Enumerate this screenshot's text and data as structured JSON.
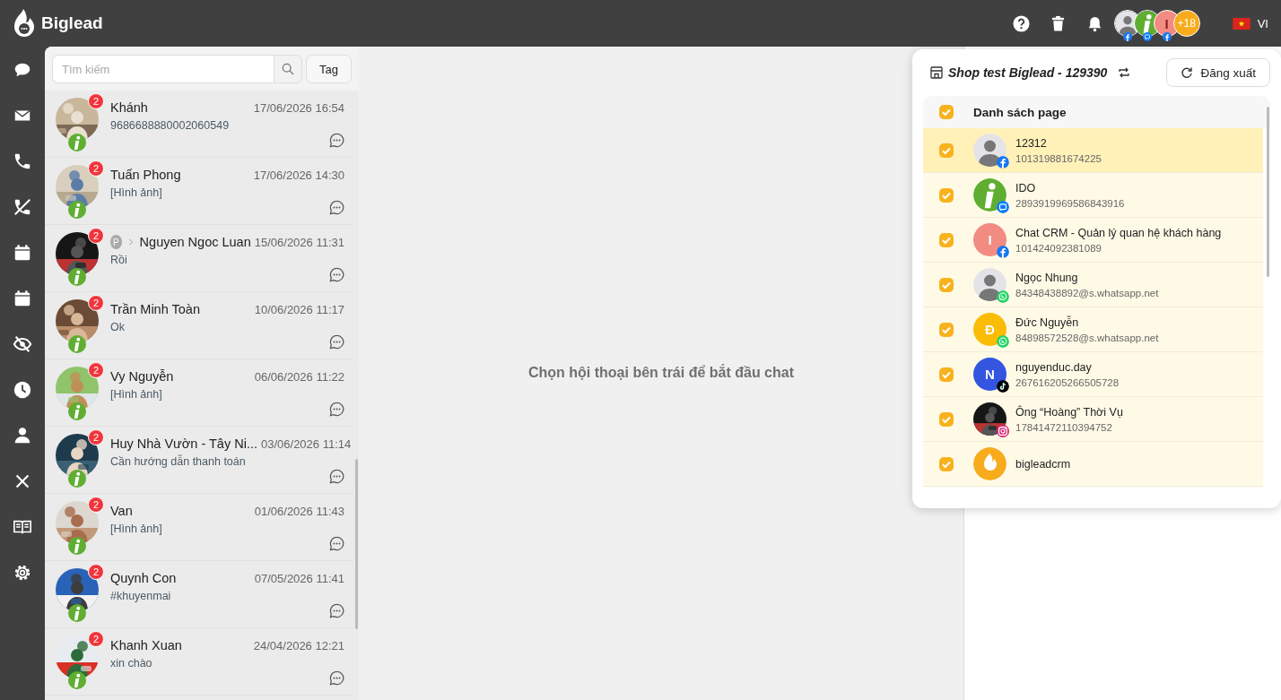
{
  "brand": {
    "name": "Biglead"
  },
  "header": {
    "accounts": [
      {
        "kind": "person",
        "badge": {
          "kind": "facebook"
        }
      },
      {
        "kind": "logo",
        "badge": {
          "kind": "zalo"
        }
      },
      {
        "kind": "initial",
        "initial": "I",
        "color": "#f28b82",
        "badge": {
          "kind": "facebook"
        }
      },
      {
        "kind": "more",
        "label": "+18",
        "color": "#f8ab1c"
      }
    ],
    "language": "VI"
  },
  "sidebar": {
    "items": [
      {
        "kind": "chat"
      },
      {
        "kind": "mail"
      },
      {
        "kind": "phone"
      },
      {
        "kind": "missed-call"
      },
      {
        "kind": "calendar"
      },
      {
        "kind": "calendar"
      },
      {
        "kind": "eye-off"
      },
      {
        "kind": "clock"
      },
      {
        "kind": "person"
      },
      {
        "kind": "close"
      },
      {
        "kind": "book"
      },
      {
        "kind": "settings"
      }
    ]
  },
  "search": {
    "placeholder": "Tìm kiếm",
    "tag_button": "Tag"
  },
  "conversations": [
    {
      "name": "Khánh",
      "time": "17/06/2026 16:54",
      "preview": "9686688880002060549",
      "unread": "2"
    },
    {
      "name": "Tuấn Phong",
      "time": "17/06/2026 14:30",
      "preview": "[Hình ảnh]",
      "unread": "2"
    },
    {
      "name": "Nguyen Ngoc Luan",
      "via": "P",
      "time": "15/06/2026 11:31",
      "preview": "Rồi",
      "unread": "2"
    },
    {
      "name": "Trần Minh Toàn",
      "time": "10/06/2026 11:17",
      "preview": "Ok",
      "unread": "2"
    },
    {
      "name": "Vy Nguyễn",
      "time": "06/06/2026 11:22",
      "preview": "[Hình ảnh]",
      "unread": "2"
    },
    {
      "name": "Huy Nhà Vườn - Tây Ni...",
      "time": "03/06/2026 11:14",
      "preview": "Cần hướng dẫn thanh toán",
      "unread": "2"
    },
    {
      "name": "Van",
      "time": "01/06/2026 11:43",
      "preview": "[Hình ảnh]",
      "unread": "2"
    },
    {
      "name": "Quynh Con",
      "time": "07/05/2026 11:41",
      "preview": "#khuyenmai",
      "unread": "2"
    },
    {
      "name": "Khanh Xuan",
      "time": "24/04/2026 12:21",
      "preview": "xin chào",
      "unread": "2"
    }
  ],
  "empty_state": "Chọn hội thoại bên trái để bắt đầu chat",
  "popup": {
    "shop": "Shop test Biglead - 129390",
    "logout": "Đăng xuất",
    "list_title": "Danh sách page",
    "all_checked": true,
    "pages": [
      {
        "name": "12312",
        "id": "101319881674225",
        "kind": "person",
        "badge": {
          "kind": "facebook"
        },
        "checked": true,
        "selected": true
      },
      {
        "name": "IDO",
        "id": "2893919969586843916",
        "kind": "logo",
        "badge": {
          "kind": "zalo"
        },
        "checked": true,
        "selected": false
      },
      {
        "name": "Chat CRM - Quản lý quan hệ khách hàng",
        "id": "101424092381089",
        "kind": "initial",
        "initial": "I",
        "color": "#f28b82",
        "badge": {
          "kind": "facebook"
        },
        "checked": true,
        "selected": false
      },
      {
        "name": "Ngọc Nhung",
        "id": "84348438892@s.whatsapp.net",
        "kind": "person-dark",
        "badge": {
          "kind": "whatsapp"
        },
        "checked": true,
        "selected": false
      },
      {
        "name": "Đức Nguyễn",
        "id": "84898572528@s.whatsapp.net",
        "kind": "initial",
        "initial": "Đ",
        "color": "#fbbc05",
        "badge": {
          "kind": "whatsapp"
        },
        "checked": true,
        "selected": false
      },
      {
        "name": "nguyenduc.day",
        "id": "267616205266505728",
        "kind": "initial",
        "initial": "N",
        "color": "#3355e0",
        "badge": {
          "kind": "tiktok"
        },
        "checked": true,
        "selected": false
      },
      {
        "name": "Ông “Hoàng” Thời Vụ",
        "id": "17841472110394752",
        "kind": "picture",
        "badge": {
          "kind": "instagram"
        },
        "checked": true,
        "selected": false
      },
      {
        "name": "bigleadcrm",
        "kind": "brand",
        "checked": true,
        "selected": false
      }
    ]
  }
}
